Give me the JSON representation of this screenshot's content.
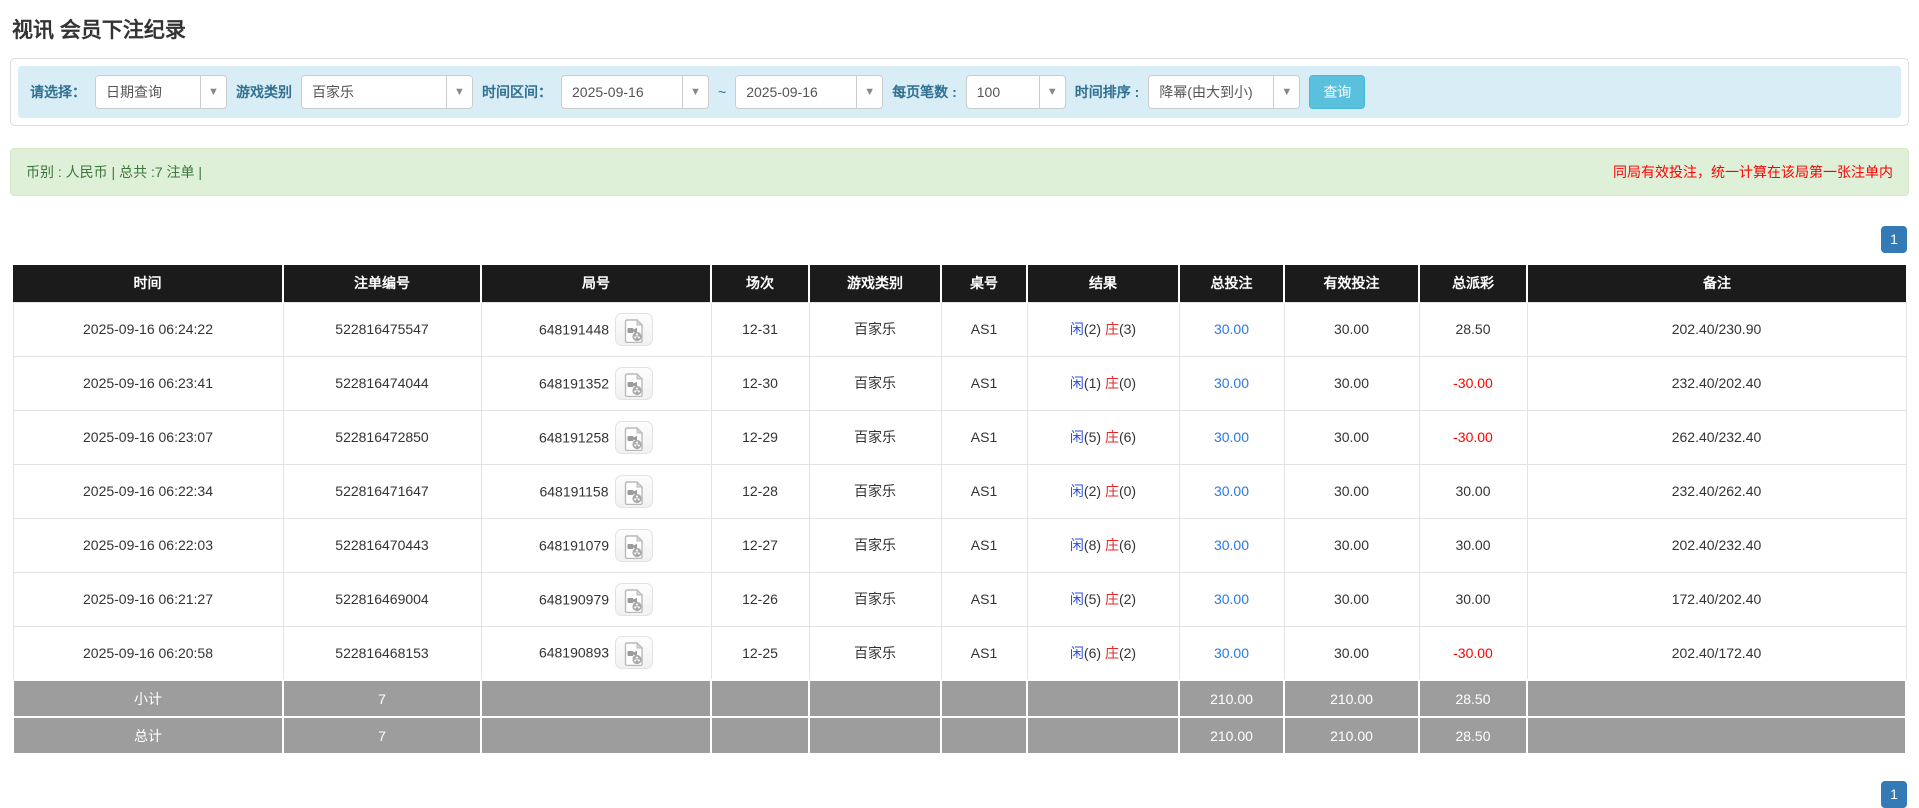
{
  "page": {
    "title": "视讯 会员下注纪录"
  },
  "filters": {
    "select_label": "请选择：",
    "select_value": "日期查询",
    "game_type_label": "游戏类别",
    "game_type_value": "百家乐",
    "time_range_label": "时间区间：",
    "date_from": "2025-09-16",
    "tilde": "~",
    "date_to": "2025-09-16",
    "page_size_label": "每页笔数 :",
    "page_size_value": "100",
    "sort_label": "时间排序 :",
    "sort_value": "降幂(由大到小)",
    "search_button": "查询"
  },
  "summary": {
    "left": "币别 : 人民币 | 总共 :7 注单 |",
    "right_notice": "同局有效投注，统一计算在该局第一张注单内"
  },
  "pagination": {
    "page": "1"
  },
  "colors": {
    "info_bar_bg": "#d9edf7",
    "success_bar_bg": "#dff0d8",
    "search_button_bg": "#5bc0de",
    "header_bg": "#1b1b1b",
    "footer_bg": "#9d9d9d",
    "link_blue": "#2a7ae2",
    "player_blue": "#2b50d9",
    "banker_red": "#e02a2a",
    "negative_red": "#ff0000",
    "pagination_blue": "#337ab7"
  },
  "table": {
    "headers": [
      "时间",
      "注单编号",
      "局号",
      "场次",
      "游戏类别",
      "桌号",
      "结果",
      "总投注",
      "有效投注",
      "总派彩",
      "备注"
    ],
    "rows": [
      {
        "time": "2025-09-16 06:24:22",
        "bet_id": "522816475547",
        "round_id": "648191448",
        "session": "12-31",
        "game": "百家乐",
        "table_no": "AS1",
        "result": {
          "p": "闲",
          "pn": "(2)",
          "b": "庄",
          "bn": "(3)"
        },
        "total_bet": "30.00",
        "valid_bet": "30.00",
        "payout": "28.50",
        "payout_neg": false,
        "remark": "202.40/230.90"
      },
      {
        "time": "2025-09-16 06:23:41",
        "bet_id": "522816474044",
        "round_id": "648191352",
        "session": "12-30",
        "game": "百家乐",
        "table_no": "AS1",
        "result": {
          "p": "闲",
          "pn": "(1)",
          "b": "庄",
          "bn": "(0)"
        },
        "total_bet": "30.00",
        "valid_bet": "30.00",
        "payout": "-30.00",
        "payout_neg": true,
        "remark": "232.40/202.40"
      },
      {
        "time": "2025-09-16 06:23:07",
        "bet_id": "522816472850",
        "round_id": "648191258",
        "session": "12-29",
        "game": "百家乐",
        "table_no": "AS1",
        "result": {
          "p": "闲",
          "pn": "(5)",
          "b": "庄",
          "bn": "(6)"
        },
        "total_bet": "30.00",
        "valid_bet": "30.00",
        "payout": "-30.00",
        "payout_neg": true,
        "remark": "262.40/232.40"
      },
      {
        "time": "2025-09-16 06:22:34",
        "bet_id": "522816471647",
        "round_id": "648191158",
        "session": "12-28",
        "game": "百家乐",
        "table_no": "AS1",
        "result": {
          "p": "闲",
          "pn": "(2)",
          "b": "庄",
          "bn": "(0)"
        },
        "total_bet": "30.00",
        "valid_bet": "30.00",
        "payout": "30.00",
        "payout_neg": false,
        "remark": "232.40/262.40"
      },
      {
        "time": "2025-09-16 06:22:03",
        "bet_id": "522816470443",
        "round_id": "648191079",
        "session": "12-27",
        "game": "百家乐",
        "table_no": "AS1",
        "result": {
          "p": "闲",
          "pn": "(8)",
          "b": "庄",
          "bn": "(6)"
        },
        "total_bet": "30.00",
        "valid_bet": "30.00",
        "payout": "30.00",
        "payout_neg": false,
        "remark": "202.40/232.40"
      },
      {
        "time": "2025-09-16 06:21:27",
        "bet_id": "522816469004",
        "round_id": "648190979",
        "session": "12-26",
        "game": "百家乐",
        "table_no": "AS1",
        "result": {
          "p": "闲",
          "pn": "(5)",
          "b": "庄",
          "bn": "(2)"
        },
        "total_bet": "30.00",
        "valid_bet": "30.00",
        "payout": "30.00",
        "payout_neg": false,
        "remark": "172.40/202.40"
      },
      {
        "time": "2025-09-16 06:20:58",
        "bet_id": "522816468153",
        "round_id": "648190893",
        "session": "12-25",
        "game": "百家乐",
        "table_no": "AS1",
        "result": {
          "p": "闲",
          "pn": "(6)",
          "b": "庄",
          "bn": "(2)"
        },
        "total_bet": "30.00",
        "valid_bet": "30.00",
        "payout": "-30.00",
        "payout_neg": true,
        "remark": "202.40/172.40"
      }
    ],
    "subtotal": {
      "label": "小计",
      "count": "7",
      "total_bet": "210.00",
      "valid_bet": "210.00",
      "payout": "28.50"
    },
    "total": {
      "label": "总计",
      "count": "7",
      "total_bet": "210.00",
      "valid_bet": "210.00",
      "payout": "28.50"
    }
  }
}
